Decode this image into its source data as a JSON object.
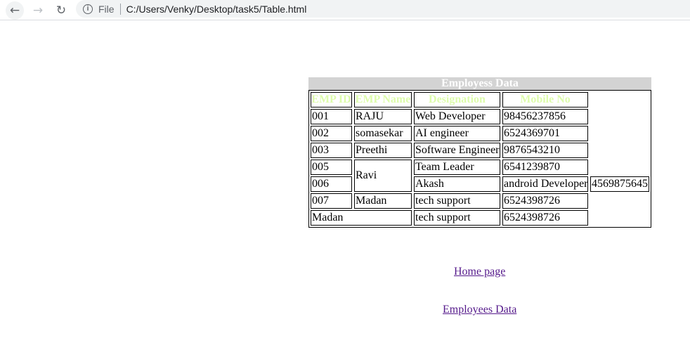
{
  "browser": {
    "back_icon": "arrow-left-icon",
    "forward_icon": "arrow-right-icon",
    "reload_icon": "reload-icon",
    "info_icon": "info-icon",
    "scheme": "File",
    "url": "C:/Users/Venky/Desktop/task5/Table.html"
  },
  "table": {
    "caption": "Employess Data",
    "headers": [
      "EMP ID",
      "EMP Name",
      "Designation",
      "Mobile No"
    ],
    "rows": [
      [
        "001",
        "RAJU",
        "Web Developer",
        "98456237856"
      ],
      [
        "002",
        "somasekar",
        "AI engineer",
        "6524369701"
      ],
      [
        "003",
        "Preethi",
        "Software Engineer",
        "9876543210"
      ],
      [
        "005",
        "Ravi",
        "Team Leader",
        "6541239870"
      ],
      [
        "006",
        "Akash",
        "android Developer",
        "4569875645"
      ],
      [
        "007",
        "Madan",
        "tech support",
        "6524398726"
      ],
      [
        "Madan",
        "tech support",
        "6524398726"
      ]
    ],
    "header_color": "#ddfcac"
  },
  "links": {
    "home": "Home page",
    "employees": "Employees Data"
  }
}
